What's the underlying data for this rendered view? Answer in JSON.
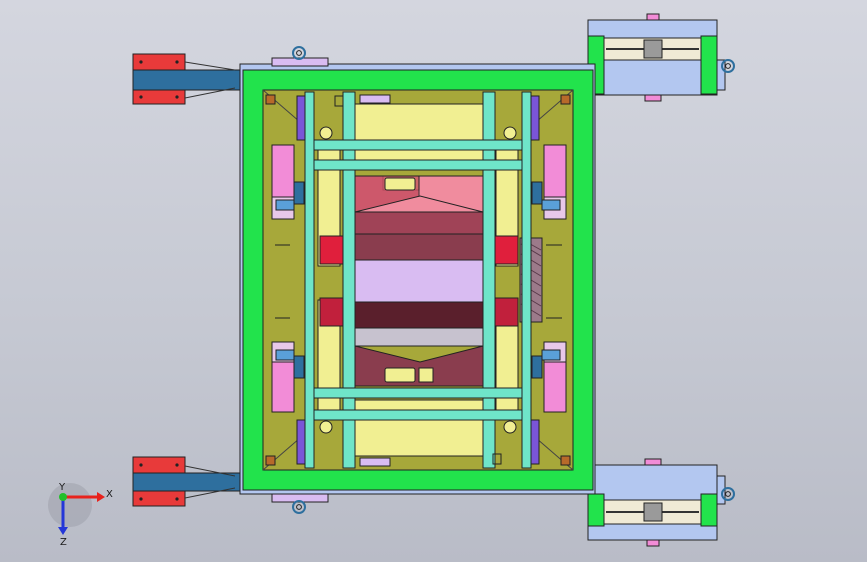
{
  "viewport": {
    "background_top": "#d4d6df",
    "background_bottom": "#b9bcc7"
  },
  "colors": {
    "frame_green": "#22e34c",
    "frame_blue": "#b3c7f0",
    "olive": "#a7a83a",
    "yellow": "#f1ef92",
    "cyan": "#6fe5c9",
    "lavender": "#d9bcf2",
    "pink": "#f28cd7",
    "red": "#e83a3a",
    "maroon": "#8a3d4e",
    "steel_blue": "#2e6f9e",
    "dark_outline": "#222222"
  },
  "triad": {
    "x_label": "X",
    "y_label": "Y",
    "z_label": "Z",
    "x_axis_color": "#e8221c",
    "y_axis_color": "#22c02a",
    "z_axis_color": "#2437d8"
  }
}
